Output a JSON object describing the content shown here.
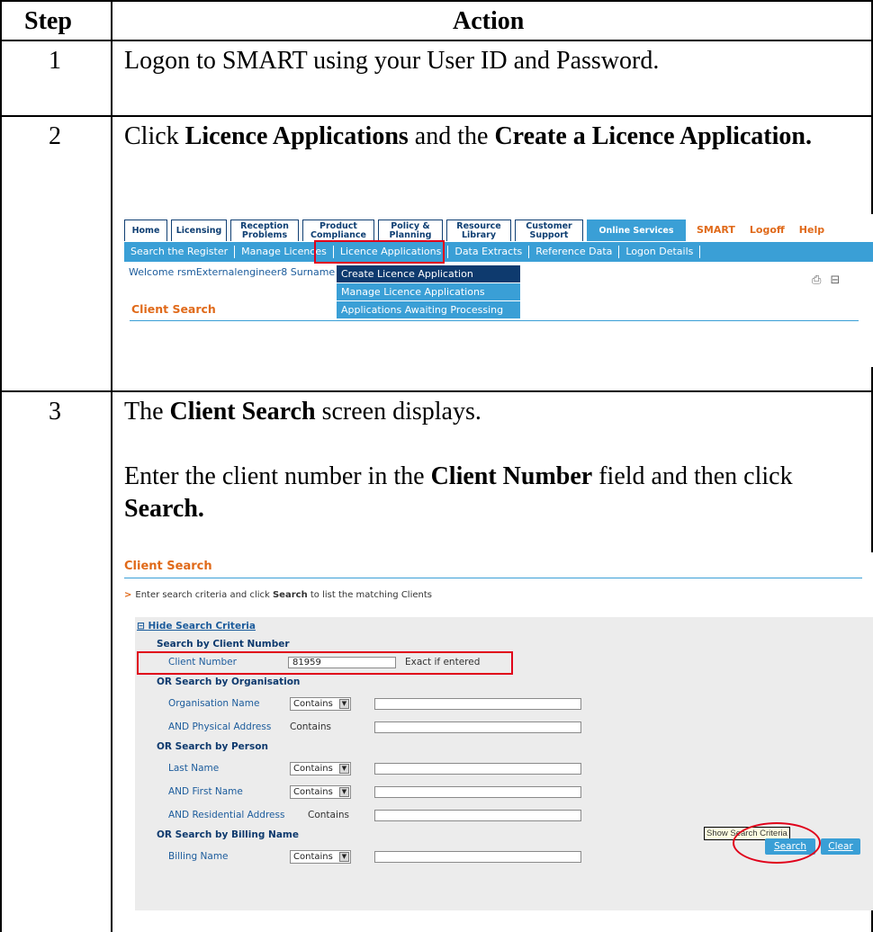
{
  "table": {
    "header_step": "Step",
    "header_action": "Action"
  },
  "steps": [
    {
      "number": "1",
      "text": "Logon to SMART using your User ID and Password."
    },
    {
      "number": "2",
      "text_a": "Click ",
      "bold_a": "Licence Applications",
      "text_b": " and the ",
      "bold_b": "Create a Licence Application."
    },
    {
      "number": "3",
      "p1_bold": "Client Search",
      "p1_rest": " screen displays.",
      "p1_pre": "The ",
      "p2_a": "Enter the client number in the ",
      "p2_bold1": "Client Number",
      "p2_b": " field and then click ",
      "p2_bold2": "Search."
    }
  ],
  "screenshot1": {
    "tabs": [
      "Home",
      "Licensing",
      "Reception Problems",
      "Product Compliance",
      "Policy & Planning",
      "Resource Library",
      "Customer Support",
      "Online Services",
      "SMART",
      "Logoff",
      "Help"
    ],
    "submenu": [
      "Search the Register",
      "Manage Licences",
      "Licence Applications",
      "Data Extracts",
      "Reference Data",
      "Logon Details"
    ],
    "welcome": "Welcome rsmExternalengineer8 Surname",
    "dropdown": [
      "Create Licence Application",
      "Manage Licence Applications",
      "Applications Awaiting Processing"
    ],
    "page_title": "Client Search"
  },
  "screenshot2": {
    "title": "Client Search",
    "instruction_pre": "Enter search criteria and click ",
    "instruction_bold": "Search",
    "instruction_post": " to list the matching Clients",
    "hide_link": "Hide Search Criteria",
    "sections": {
      "client_number": "Search by Client Number",
      "organisation": "OR Search by Organisation",
      "person": "OR Search by Person",
      "billing": "OR Search by Billing Name"
    },
    "labels": {
      "client_number": "Client Number",
      "organisation_name": "Organisation Name",
      "physical_address": "AND Physical Address",
      "last_name": "Last Name",
      "first_name": "AND First Name",
      "residential_address": "AND Residential Address",
      "billing_name": "Billing Name"
    },
    "client_number_value": "81959",
    "exact_note": "Exact if entered",
    "contains": "Contains",
    "tooltip": "Show Search Criteria",
    "search_button": "Search",
    "clear_button": "Clear"
  }
}
